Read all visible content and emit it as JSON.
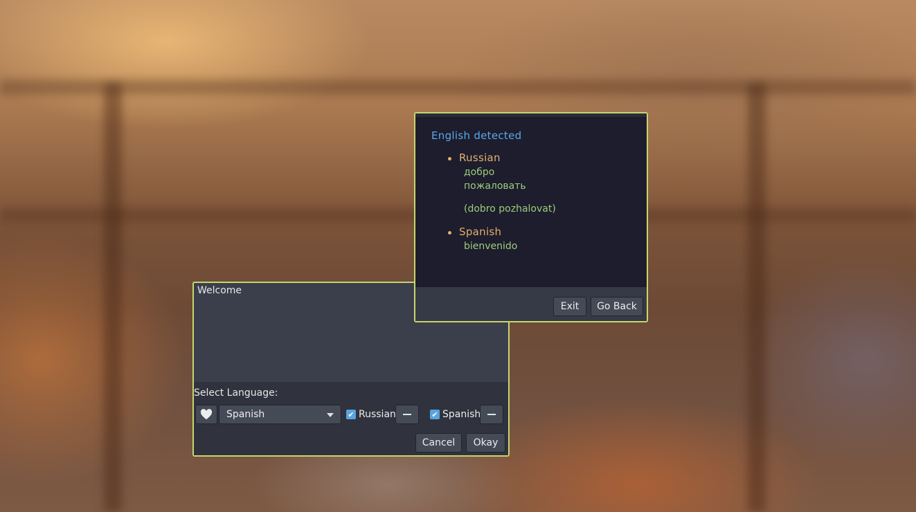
{
  "welcome_dialog": {
    "title": "Welcome",
    "select_label": "Select Language:",
    "favorite_icon": "heart-icon",
    "dropdown": {
      "selected": "Spanish"
    },
    "checkboxes": [
      {
        "label": "Russian",
        "checked": true
      },
      {
        "label": "Spanish",
        "checked": true
      }
    ],
    "cancel_label": "Cancel",
    "okay_label": "Okay"
  },
  "detect_dialog": {
    "heading": "English detected",
    "languages": [
      {
        "name": "Russian",
        "words": [
          "добро",
          "пожаловать"
        ],
        "transliteration": "(dobro pozhalovat)"
      },
      {
        "name": "Spanish",
        "words": [
          "bienvenido"
        ]
      }
    ],
    "exit_label": "Exit",
    "go_back_label": "Go Back"
  },
  "colors": {
    "accent_border": "#c8d66c",
    "heading": "#5ba9e8",
    "language_name": "#e3b06a",
    "translation": "#9fcc7a",
    "checkbox": "#5aa3e0"
  }
}
